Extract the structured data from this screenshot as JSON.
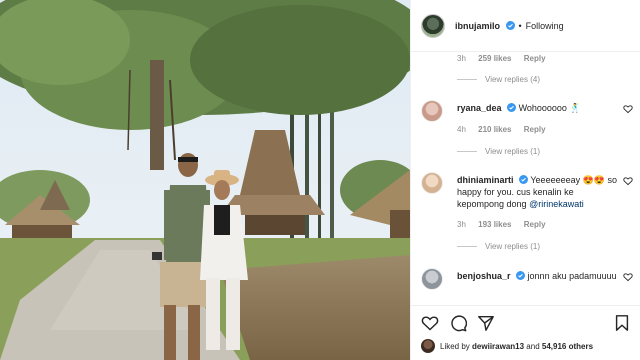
{
  "post": {
    "username": "ibnujamilo",
    "follow_status": "Following",
    "separator": "•"
  },
  "comments": [
    {
      "time": "3h",
      "likes": "259 likes",
      "reply_label": "Reply",
      "view_replies": "View replies (4)"
    },
    {
      "username": "ryana_dea",
      "text": "Wohoooooo 🕺",
      "time": "4h",
      "likes": "210 likes",
      "reply_label": "Reply",
      "view_replies": "View replies (1)"
    },
    {
      "username": "dhiniaminarti",
      "text": "Yeeeeeeeay 😍😍 so happy for you. cus kenalin ke kepompong dong",
      "mention": "@ririnekawati",
      "time": "3h",
      "likes": "193 likes",
      "reply_label": "Reply",
      "view_replies": "View replies (1)"
    },
    {
      "username": "benjoshua_r",
      "text": "jonnn aku padamuuuu"
    }
  ],
  "likes_bar": {
    "prefix": "Liked by",
    "liker": "dewiirawan13",
    "middle": "and",
    "others": "54,916 others"
  },
  "icons": {
    "verified": "verified-badge-icon",
    "heart": "heart-icon",
    "comment": "comment-icon",
    "share": "share-icon",
    "save": "bookmark-icon"
  },
  "colors": {
    "verified": "#3897f0",
    "text": "#262626",
    "muted": "#8e8e8e",
    "link": "#00376b"
  }
}
